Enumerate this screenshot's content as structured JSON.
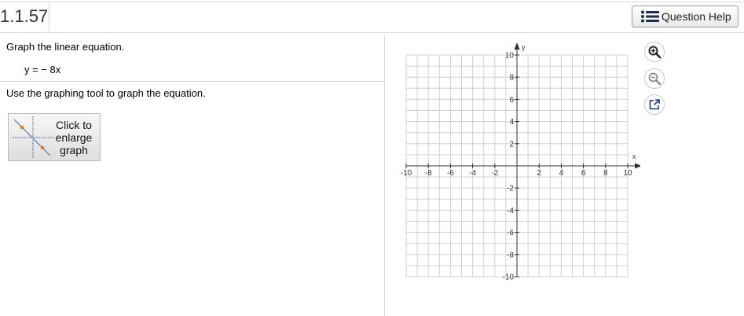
{
  "header": {
    "question_number": "1.1.57",
    "help_button_label": "Question Help"
  },
  "problem": {
    "prompt": "Graph the linear equation.",
    "equation": "y = − 8x",
    "instruction": "Use the graphing tool to graph the equation.",
    "enlarge_label_line1": "Click to",
    "enlarge_label_line2": "enlarge",
    "enlarge_label_line3": "graph"
  },
  "graph": {
    "x_axis_label": "x",
    "y_axis_label": "y",
    "x_range": [
      -10,
      10
    ],
    "y_range": [
      -10,
      10
    ],
    "grid_step": 1,
    "x_tick_labels": [
      "-10",
      "-8",
      "-6",
      "-4",
      "-2",
      "2",
      "4",
      "6",
      "8",
      "10"
    ],
    "y_tick_labels": [
      "10",
      "8",
      "6",
      "4",
      "2",
      "-2",
      "-4",
      "-6",
      "-8",
      "-10"
    ],
    "grid": true,
    "colors": {
      "grid": "#d0d0d0",
      "axis": "#333333",
      "accent": "#1a3d7c",
      "muted": "#8a8a8a"
    }
  },
  "toolbar": {
    "zoom_in_icon": "zoom-in-icon",
    "zoom_out_icon": "zoom-out-icon",
    "popout_icon": "external-window-icon"
  }
}
